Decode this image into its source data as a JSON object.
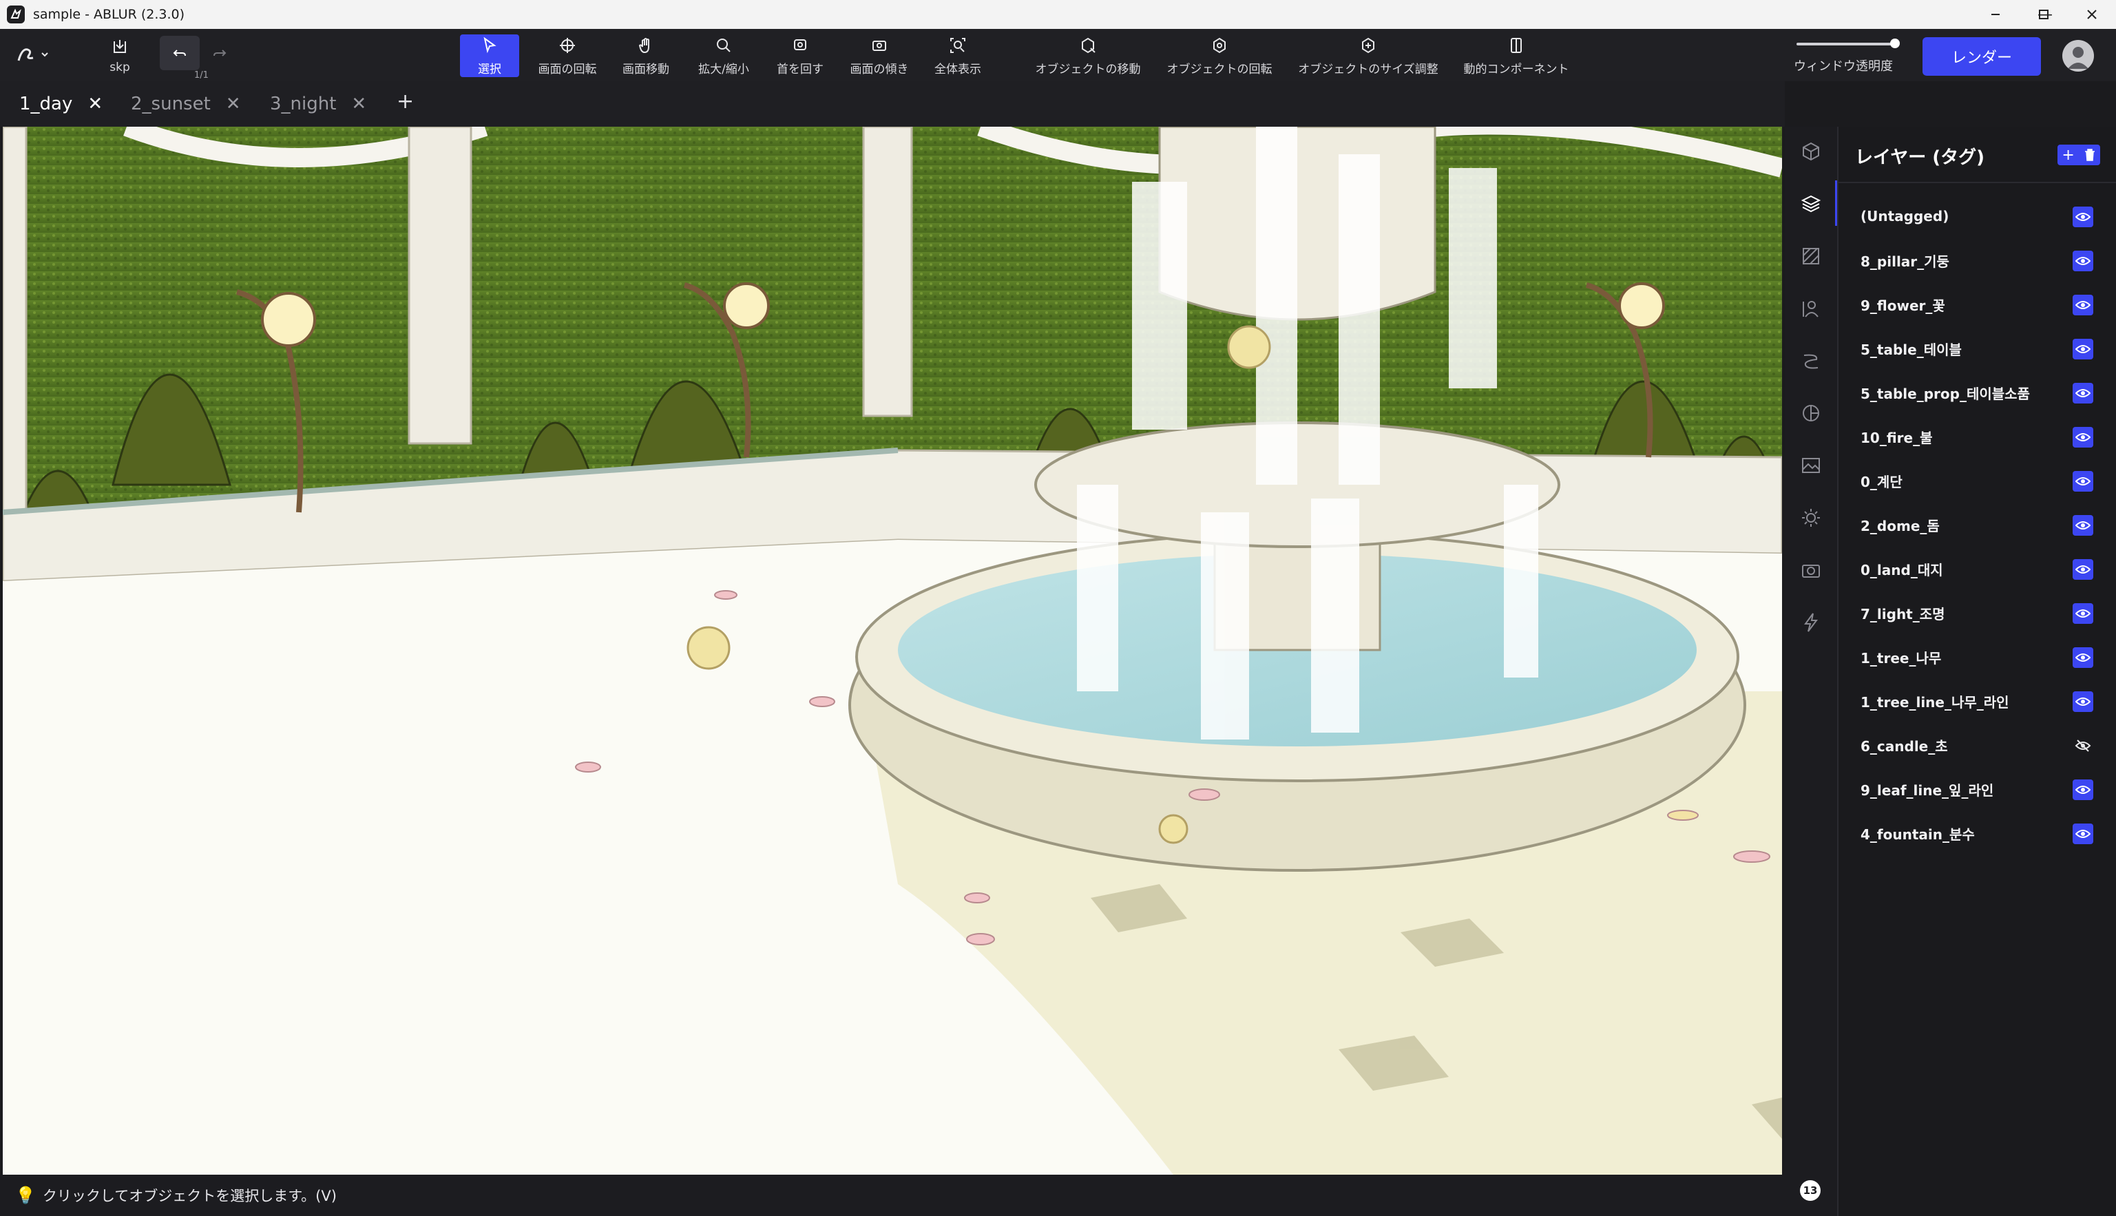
{
  "window": {
    "title": "sample - ABLUR (2.3.0)"
  },
  "toolbar": {
    "export_label": "skp",
    "undo_count": "1/1",
    "tools": [
      {
        "id": "select",
        "label": "選択",
        "active": true
      },
      {
        "id": "rotate-view",
        "label": "画面の回転"
      },
      {
        "id": "pan-view",
        "label": "画面移動"
      },
      {
        "id": "zoom",
        "label": "拡大/縮小"
      },
      {
        "id": "turn-head",
        "label": "首を回す"
      },
      {
        "id": "tilt-view",
        "label": "画面の傾き"
      },
      {
        "id": "fit-all",
        "label": "全体表示"
      },
      {
        "id": "move-object",
        "label": "オブジェクトの移動"
      },
      {
        "id": "rotate-object",
        "label": "オブジェクトの回転"
      },
      {
        "id": "scale-object",
        "label": "オブジェクトのサイズ調整"
      },
      {
        "id": "dynamic-component",
        "label": "動的コンポーネント"
      }
    ],
    "opacity_label": "ウィンドウ透明度",
    "opacity_value": 1.0,
    "render_label": "レンダー"
  },
  "tabs": [
    {
      "label": "1_day",
      "active": true
    },
    {
      "label": "2_sunset"
    },
    {
      "label": "3_night"
    }
  ],
  "tab_add": "+",
  "status": {
    "message": "クリックしてオブジェクトを選択します。(V)"
  },
  "side_icons": [
    "cube-icon",
    "layers-icon",
    "texture-icon",
    "character-icon",
    "line-icon",
    "style-icon",
    "image-icon",
    "light-icon",
    "camera-icon",
    "effect-icon"
  ],
  "help_label": "13",
  "layers_panel": {
    "title": "レイヤー (タグ)",
    "add": "+",
    "layers": [
      {
        "name": "(Untagged)",
        "visible": true
      },
      {
        "name": "8_pillar_기둥",
        "visible": true
      },
      {
        "name": "9_flower_꽃",
        "visible": true
      },
      {
        "name": "5_table_테이블",
        "visible": true
      },
      {
        "name": "5_table_prop_테이블소품",
        "visible": true
      },
      {
        "name": "10_fire_불",
        "visible": true
      },
      {
        "name": "0_계단",
        "visible": true
      },
      {
        "name": "2_dome_돔",
        "visible": true
      },
      {
        "name": "0_land_대지",
        "visible": true
      },
      {
        "name": "7_light_조명",
        "visible": true
      },
      {
        "name": "1_tree_나무",
        "visible": true
      },
      {
        "name": "1_tree_line_나무_라인",
        "visible": true
      },
      {
        "name": "6_candle_초",
        "visible": false
      },
      {
        "name": "9_leaf_line_잎_라인",
        "visible": true
      },
      {
        "name": "4_fountain_분수",
        "visible": true
      }
    ]
  },
  "colors": {
    "accent": "#3c46f2",
    "toolbar_bg": "#202024",
    "panel_bg": "#1a1a1d"
  }
}
